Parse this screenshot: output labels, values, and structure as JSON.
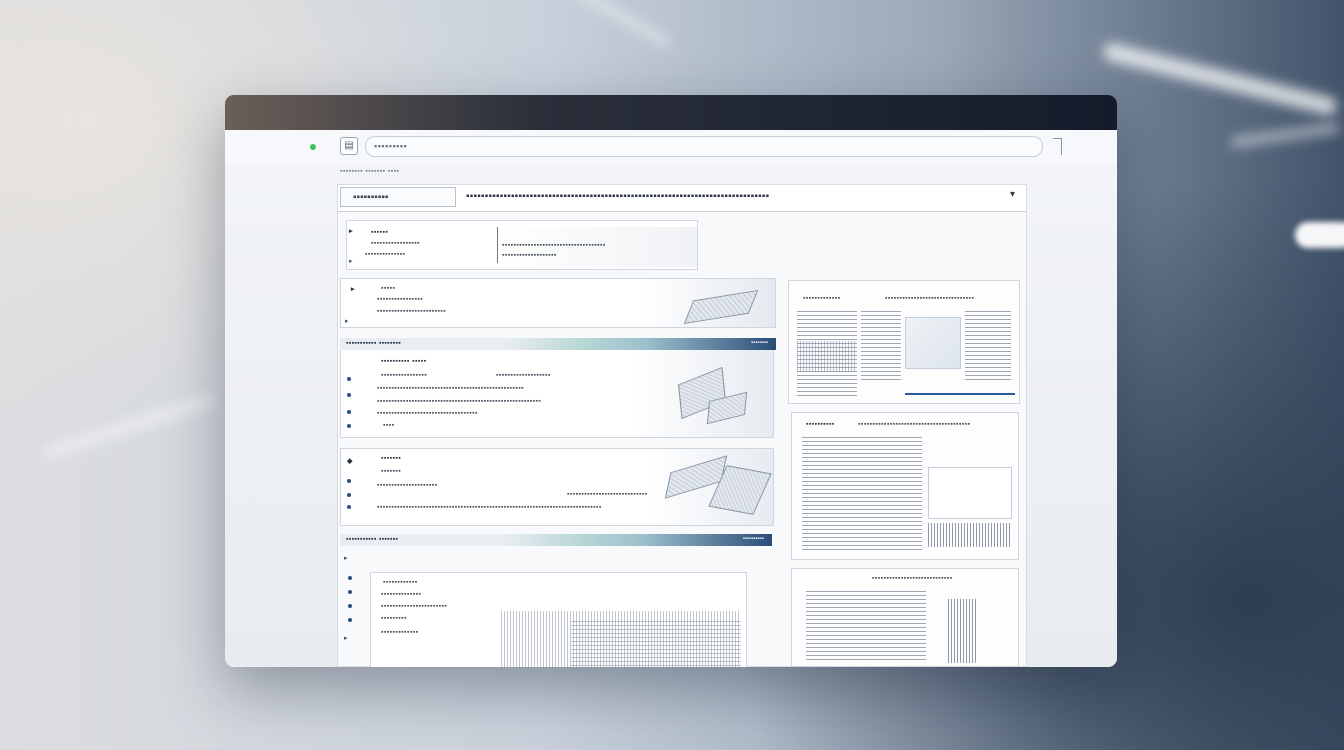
{
  "toolbar": {
    "page_icon": "page-icon",
    "address_text": "▪▪▪▪▪▪▪▪▪"
  },
  "breadcrumb": "▪▪▪▪▪▪▪▪ ▪▪▪▪▪▪▪ ▪▪▪▪",
  "header": {
    "tab_label": "▪▪▪▪▪▪▪▪▪▪",
    "title": "▪▪▪▪▪▪▪▪▪▪▪▪▪▪▪▪▪▪▪▪▪▪▪▪▪▪▪▪▪▪▪▪▪▪▪▪▪▪▪▪▪▪▪▪▪▪▪▪▪▪▪▪▪▪▪▪▪▪▪▪▪▪▪▪▪▪▪▪▪▪▪▪▪▪▪▪▪▪▪▪▪",
    "chevron_icon": "chevron-down-icon"
  },
  "cards": [
    {
      "heading": "▪▪▪▪▪▪",
      "lines": [
        "▪▪▪▪▪▪▪▪▪▪▪▪▪▪▪▪▪",
        "▪▪▪▪▪▪▪▪▪▪▪▪▪▪"
      ],
      "extra": "▪▪▪▪▪▪▪▪▪▪▪▪▪▪▪▪▪▪▪▪▪▪▪▪▪▪▪▪▪▪▪▪▪▪▪▪",
      "extra2": "▪▪▪▪▪▪▪▪▪▪▪▪▪▪▪▪▪▪▪"
    },
    {
      "heading": "▪▪▪▪▪",
      "lines": [
        "▪▪▪▪▪▪▪▪▪▪▪▪▪▪▪▪",
        "▪▪▪▪▪▪▪▪▪▪▪▪▪▪▪▪▪▪▪▪▪▪▪▪"
      ]
    },
    {
      "band": "▪▪▪▪▪▪▪▪▪▪▪ ▪▪▪▪▪▪▪▪",
      "band_right": "▪▪▪▪▪▪▪▪",
      "heading": "▪▪▪▪▪▪▪▪▪▪   ▪▪▪▪▪",
      "lines": [
        "▪▪▪▪▪▪▪▪▪▪▪▪▪▪▪▪",
        "▪▪▪▪▪▪▪▪▪▪▪▪▪▪▪▪▪▪▪▪▪▪▪▪▪▪▪▪▪▪▪▪▪▪▪▪▪▪▪▪▪▪▪▪▪▪▪▪▪▪▪",
        "▪▪▪▪▪▪▪▪▪▪▪▪▪▪▪▪▪▪▪▪▪▪▪▪▪▪▪▪▪▪▪▪▪▪▪▪▪▪▪▪▪▪▪▪▪▪▪▪▪▪▪▪▪▪▪▪▪",
        "▪▪▪▪▪▪▪▪▪▪▪▪▪▪▪▪▪▪▪▪▪▪▪▪▪▪▪▪▪▪▪▪▪▪▪",
        "▪▪▪▪"
      ],
      "mid": "▪▪▪▪▪▪▪▪▪▪▪▪▪▪▪▪▪▪▪"
    },
    {
      "heading": "▪▪▪▪▪▪▪",
      "lines": [
        "▪▪▪▪▪▪▪",
        "▪▪▪▪▪▪▪▪▪▪▪▪▪▪▪▪▪▪▪▪▪",
        "▪▪▪▪▪▪▪▪▪▪▪▪▪▪▪▪▪▪▪▪▪▪▪▪▪▪▪▪▪▪▪▪▪▪▪▪▪▪▪▪▪▪▪▪▪▪▪▪▪▪▪▪▪▪▪▪▪▪▪▪▪▪▪▪▪▪▪▪▪▪▪▪▪▪▪▪▪▪"
      ],
      "mid": "▪▪▪▪▪▪▪▪▪▪▪▪▪▪▪▪▪▪▪▪▪▪▪▪▪▪▪▪"
    },
    {
      "band": "▪▪▪▪▪▪▪▪▪▪▪ ▪▪▪▪▪▪▪",
      "band_right": "▪▪▪▪▪▪▪▪▪▪",
      "lines": [
        "▪▪▪▪▪▪▪▪▪▪▪▪",
        "▪▪▪▪▪▪▪▪▪▪▪▪▪▪",
        "▪▪▪▪▪▪▪▪▪▪▪▪▪▪▪▪▪▪▪▪▪▪▪",
        "▪▪▪▪▪▪▪▪▪",
        "▪▪▪▪▪▪▪▪▪▪▪▪▪"
      ]
    }
  ],
  "side": {
    "sheet1_head": "▪▪▪▪▪▪▪▪▪▪▪▪▪",
    "sheet1_head2": "▪▪▪▪▪▪▪▪▪▪▪▪▪▪▪▪▪▪▪▪▪▪▪▪▪▪▪▪▪▪▪",
    "sheet2_head": "▪▪▪▪▪▪▪▪▪▪",
    "sheet2_head2": "▪▪▪▪▪▪▪▪▪▪▪▪▪▪▪▪▪▪▪▪▪▪▪▪▪▪▪▪▪▪▪▪▪▪▪▪▪▪▪",
    "sheet3_head": "▪▪▪▪▪▪▪▪▪▪▪▪▪▪▪▪▪▪▪▪▪▪▪▪▪▪▪▪"
  }
}
